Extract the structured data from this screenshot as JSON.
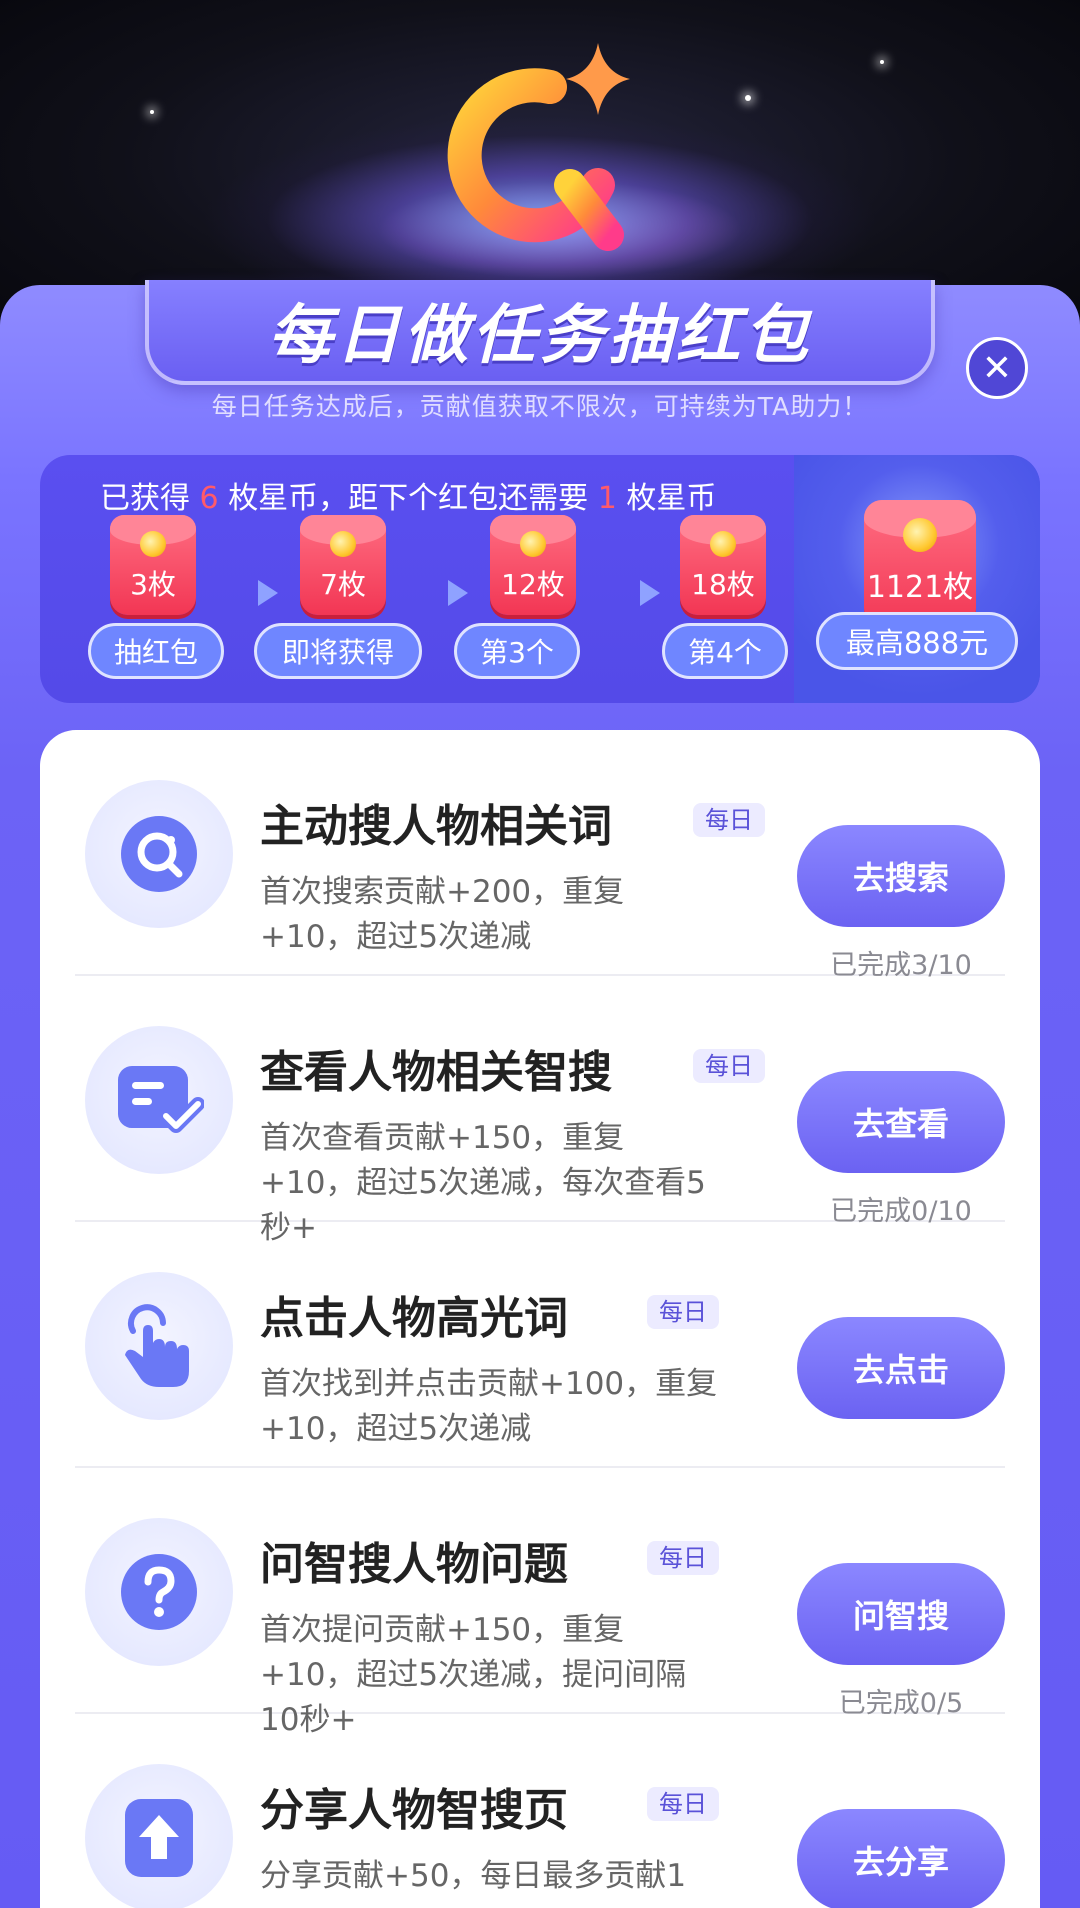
{
  "header": {
    "title": "每日做任务抽红包",
    "subtitle": "每日任务达成后，贡献值获取不限次，可持续为TA助力！"
  },
  "progress": {
    "text_prefix": "已获得",
    "earned": "6",
    "text_middle": "枚星币，距下个红包还需要",
    "needed": "1",
    "text_suffix": "枚星币",
    "milestones": [
      {
        "amount": "3枚",
        "label": "抽红包"
      },
      {
        "amount": "7枚",
        "label": "即将获得"
      },
      {
        "amount": "12枚",
        "label": "第3个"
      },
      {
        "amount": "18枚",
        "label": "第4个"
      }
    ],
    "max": {
      "amount": "1121枚",
      "label": "最高888元"
    }
  },
  "tasks": [
    {
      "icon": "search-icon",
      "title": "主动搜人物相关词",
      "tag": "每日",
      "desc": "首次搜索贡献+200，重复+10，超过5次递减",
      "button": "去搜索",
      "status": "已完成3/10"
    },
    {
      "icon": "document-check-icon",
      "title": "查看人物相关智搜",
      "tag": "每日",
      "desc": "首次查看贡献+150，重复+10，超过5次递减，每次查看5秒+",
      "button": "去查看",
      "status": "已完成0/10"
    },
    {
      "icon": "tap-hand-icon",
      "title": "点击人物高光词",
      "tag": "每日",
      "desc": "首次找到并点击贡献+100，重复+10，超过5次递减",
      "button": "去点击",
      "status": ""
    },
    {
      "icon": "question-icon",
      "title": "问智搜人物问题",
      "tag": "每日",
      "desc": "首次提问贡献+150，重复+10，超过5次递减，提问间隔10秒+",
      "button": "问智搜",
      "status": "已完成0/5"
    },
    {
      "icon": "share-icon",
      "title": "分享人物智搜页",
      "tag": "每日",
      "desc": "分享贡献+50，每日最多贡献1",
      "button": "去分享",
      "status": ""
    }
  ],
  "colors": {
    "primary": "#6c63f6",
    "accent_red": "#ff5a6a",
    "red_envelope": "#f23654"
  }
}
